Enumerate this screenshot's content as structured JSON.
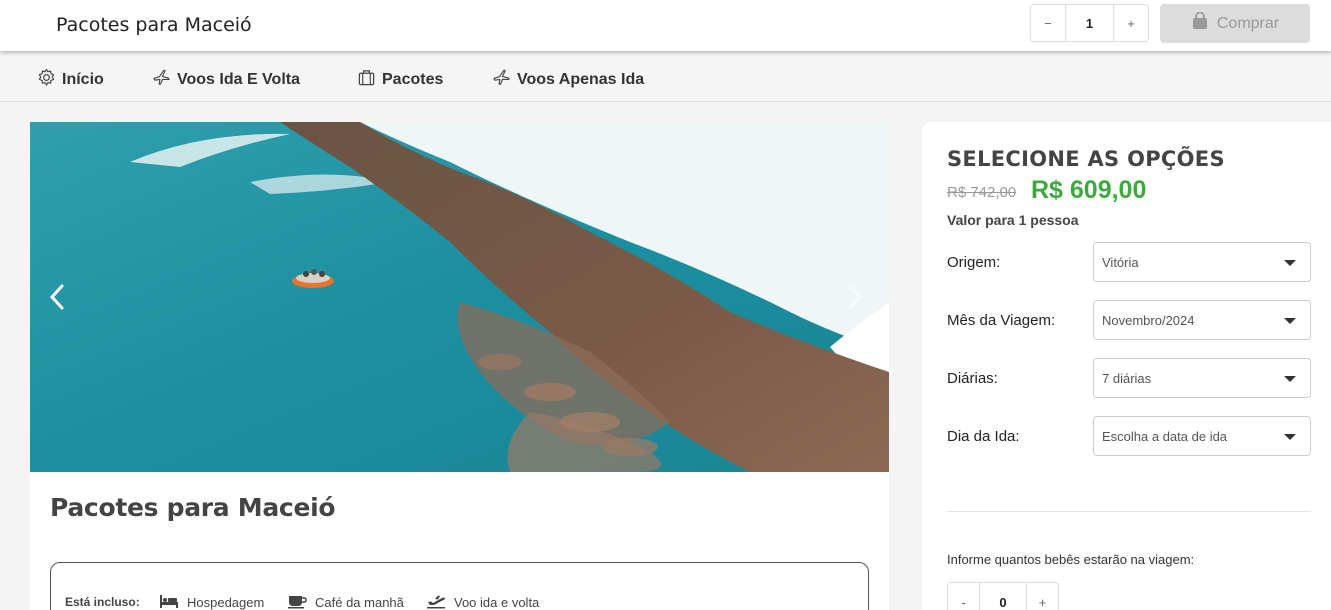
{
  "header": {
    "title": "Pacotes para Maceió",
    "quantity": {
      "minus": "−",
      "value": "1",
      "plus": "+"
    },
    "buy_label": "Comprar"
  },
  "nav": {
    "items": [
      {
        "label": "Início",
        "icon": "gear-icon"
      },
      {
        "label": "Voos Ida E Volta",
        "icon": "airplane-icon"
      },
      {
        "label": "Pacotes",
        "icon": "suitcase-icon"
      },
      {
        "label": "Voos Apenas Ida",
        "icon": "airplane-icon"
      }
    ]
  },
  "package": {
    "title": "Pacotes para Maceió",
    "included_label": "Está incluso:",
    "included": [
      {
        "label": "Hospedagem",
        "icon": "bed-icon"
      },
      {
        "label": "Café da manhã",
        "icon": "coffee-cup-icon"
      },
      {
        "label": "Voo ida e volta",
        "icon": "plane-takeoff-icon"
      }
    ]
  },
  "options": {
    "title": "SELECIONE AS OPÇÕES",
    "old_price": "R$ 742,00",
    "new_price": "R$ 609,00",
    "price_note": "Valor para 1 pessoa",
    "fields": [
      {
        "label": "Origem:",
        "value": "Vitória"
      },
      {
        "label": "Mês da Viagem:",
        "value": "Novembro/2024"
      },
      {
        "label": "Diárias:",
        "value": "7 diárias"
      },
      {
        "label": "Dia da Ida:",
        "value": "Escolha a data de ida"
      }
    ],
    "babies_label": "Informe quantos bebês estarão na viagem:",
    "babies": {
      "minus": "-",
      "value": "0",
      "plus": "+"
    }
  },
  "colors": {
    "price_green": "#3daa3d",
    "buy_button_bg": "#dcdcdc"
  }
}
